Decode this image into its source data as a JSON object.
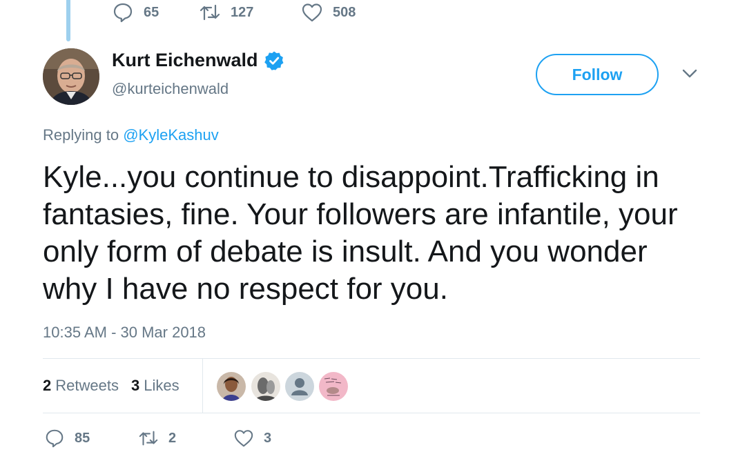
{
  "previous_tweet": {
    "replies": "65",
    "retweets": "127",
    "likes": "508"
  },
  "tweet": {
    "author_name": "Kurt Eichenwald",
    "author_handle": "@kurteichenwald",
    "follow_label": "Follow",
    "replying_prefix": "Replying to ",
    "replying_to": "@KyleKashuv",
    "text": "Kyle...you continue to disappoint.Trafficking in fantasies, fine. Your followers are infantile, your only form of debate is insult. And you wonder why I have no respect for you.",
    "timestamp": "10:35 AM - 30 Mar 2018"
  },
  "stats": {
    "retweets_count": "2",
    "retweets_label": "Retweets",
    "likes_count": "3",
    "likes_label": "Likes"
  },
  "actions": {
    "replies": "85",
    "retweets": "2",
    "likes": "3"
  },
  "colors": {
    "accent": "#1da1f2",
    "secondary_text": "#657786",
    "thread_line": "#9ed0ee"
  }
}
